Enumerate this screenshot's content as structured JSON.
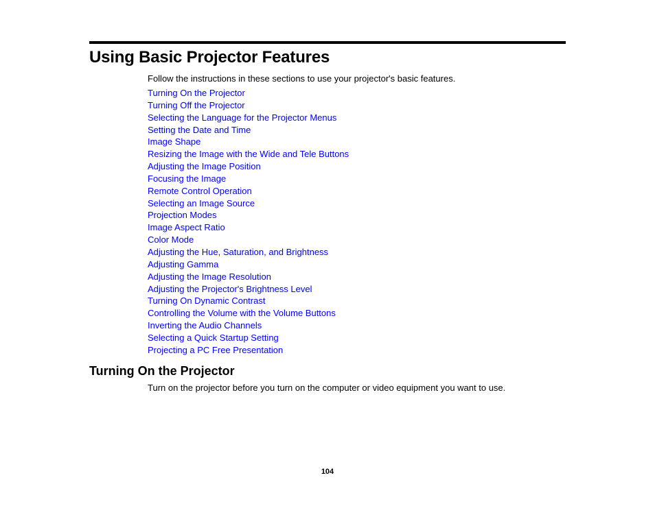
{
  "page": {
    "title": "Using Basic Projector Features",
    "intro": "Follow the instructions in these sections to use your projector's basic features.",
    "links": [
      "Turning On the Projector",
      "Turning Off the Projector",
      "Selecting the Language for the Projector Menus",
      "Setting the Date and Time",
      "Image Shape",
      "Resizing the Image with the Wide and Tele Buttons",
      "Adjusting the Image Position",
      "Focusing the Image",
      "Remote Control Operation",
      "Selecting an Image Source",
      "Projection Modes",
      "Image Aspect Ratio",
      "Color Mode",
      "Adjusting the Hue, Saturation, and Brightness",
      "Adjusting Gamma",
      "Adjusting the Image Resolution",
      "Adjusting the Projector's Brightness Level",
      "Turning On Dynamic Contrast",
      "Controlling the Volume with the Volume Buttons",
      "Inverting the Audio Channels",
      "Selecting a Quick Startup Setting",
      "Projecting a PC Free Presentation"
    ],
    "link_color": "#0000ff"
  },
  "section": {
    "title": "Turning On the Projector",
    "body": "Turn on the projector before you turn on the computer or video equipment you want to use."
  },
  "footer": {
    "page_number": "104"
  }
}
